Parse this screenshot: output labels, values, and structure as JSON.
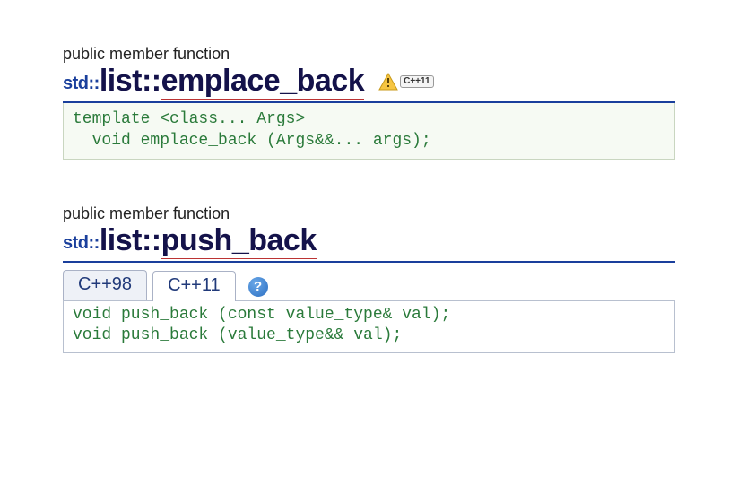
{
  "emplace": {
    "kind": "public member function",
    "ns": "std::",
    "cls": "list",
    "sep": "::",
    "fn": "emplace_back",
    "badge": "C++11",
    "code": "template <class... Args>\n  void emplace_back (Args&&... args);"
  },
  "push": {
    "kind": "public member function",
    "ns": "std::",
    "cls": "list",
    "sep": "::",
    "fn": "push_back",
    "tabs": [
      "C++98",
      "C++11"
    ],
    "active_tab_index": 1,
    "help": "?",
    "code": "void push_back (const value_type& val);\nvoid push_back (value_type&& val);"
  }
}
